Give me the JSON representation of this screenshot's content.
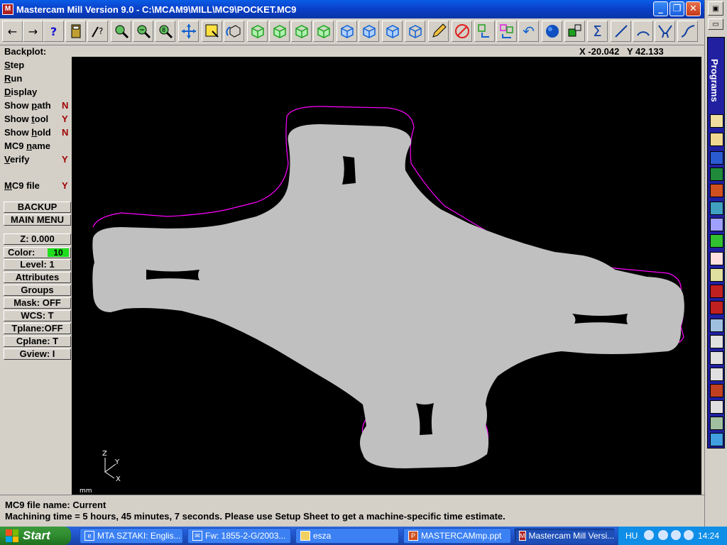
{
  "window": {
    "title": "Mastercam Mill Version 9.0 - C:\\MCAM9\\MILL\\MC9\\POCKET.MC9",
    "app_icon": "mastercam-icon",
    "minimize": "_",
    "maximize": "❐",
    "close": "✕"
  },
  "toolbar": {
    "buttons": [
      {
        "name": "back-arrow-icon",
        "glyph": "←"
      },
      {
        "name": "forward-arrow-icon",
        "glyph": "→"
      },
      {
        "name": "help-icon",
        "glyph": "?"
      },
      {
        "name": "calculator-icon",
        "glyph": ""
      },
      {
        "name": "analyze-icon",
        "glyph": ""
      },
      {
        "name": "zoom-window-icon",
        "glyph": ""
      },
      {
        "name": "zoom-out-icon",
        "glyph": ""
      },
      {
        "name": "zoom-fit-icon",
        "glyph": ""
      },
      {
        "name": "pan-icon",
        "glyph": ""
      },
      {
        "name": "select-window-icon",
        "glyph": ""
      },
      {
        "name": "rotate-view-icon",
        "glyph": ""
      },
      {
        "name": "view-iso-1-icon",
        "glyph": ""
      },
      {
        "name": "view-iso-2-icon",
        "glyph": ""
      },
      {
        "name": "view-iso-3-icon",
        "glyph": ""
      },
      {
        "name": "view-iso-4-icon",
        "glyph": ""
      },
      {
        "name": "view-top-icon",
        "glyph": ""
      },
      {
        "name": "view-front-icon",
        "glyph": ""
      },
      {
        "name": "view-side-icon",
        "glyph": ""
      },
      {
        "name": "view-iso-icon",
        "glyph": ""
      },
      {
        "name": "edit-pencil-icon",
        "glyph": ""
      },
      {
        "name": "erase-icon",
        "glyph": ""
      },
      {
        "name": "transform-icon",
        "glyph": ""
      },
      {
        "name": "translate-icon",
        "glyph": ""
      },
      {
        "name": "undo-icon",
        "glyph": "↶"
      },
      {
        "name": "shade-sphere-icon",
        "glyph": ""
      },
      {
        "name": "group-icon",
        "glyph": ""
      },
      {
        "name": "sum-icon",
        "glyph": "Σ"
      },
      {
        "name": "line-icon",
        "glyph": "╱"
      },
      {
        "name": "arc-icon",
        "glyph": "⌒"
      },
      {
        "name": "fillet-icon",
        "glyph": ""
      },
      {
        "name": "spline-icon",
        "glyph": "∿"
      }
    ]
  },
  "info": {
    "mode_label": "Backplot:",
    "coords": "X -20.042   Y 42.133"
  },
  "menu": {
    "items": [
      {
        "label": "Step",
        "underline": "S",
        "rest": "tep",
        "value": ""
      },
      {
        "label": "Run",
        "underline": "R",
        "rest": "un",
        "value": ""
      },
      {
        "label": "Display",
        "underline": "D",
        "rest": "isplay",
        "value": ""
      },
      {
        "label": "Show path",
        "pre": "Show ",
        "underline": "p",
        "rest": "ath",
        "value": "N"
      },
      {
        "label": "Show tool",
        "pre": "Show ",
        "underline": "t",
        "rest": "ool",
        "value": "Y"
      },
      {
        "label": "Show hold",
        "pre": "Show ",
        "underline": "h",
        "rest": "old",
        "value": "N"
      },
      {
        "label": "MC9 name",
        "pre": "MC9 ",
        "underline": "n",
        "rest": "ame",
        "value": ""
      },
      {
        "label": "Verify",
        "underline": "V",
        "rest": "erify",
        "value": "Y"
      },
      {
        "label": "MC9 file",
        "underline": "M",
        "rest": "C9 file",
        "value": "Y"
      }
    ],
    "backup": "BACKUP",
    "main_menu": "MAIN MENU",
    "z": "Z:  0.000",
    "color_label": "Color:",
    "color_value": "10",
    "level": "Level:  1",
    "attributes": "Attributes",
    "groups": "Groups",
    "mask": "Mask:  OFF",
    "wcs": "WCS:   T",
    "tplane": "Tplane:OFF",
    "cplane": "Cplane:  T",
    "gview": "Gview:   I"
  },
  "viewport": {
    "axis_z": "Z",
    "axis_y": "Y",
    "axis_x": "X",
    "units": "mm",
    "part_color": "#c0c0c0",
    "toolpath_color": "#ff00ff"
  },
  "status": {
    "line1": "MC9 file name: Current",
    "line2": "Machining time = 5 hours, 45 minutes, 7 seconds. Please use Setup Sheet to get a machine-specific time estimate."
  },
  "taskbar": {
    "start": "Start",
    "tasks": [
      {
        "label": "MTA SZTAKI: Englis...",
        "icon": "browser-icon"
      },
      {
        "label": "Fw: 1855-2-G/2003...",
        "icon": "mail-icon"
      },
      {
        "label": "esza",
        "icon": "folder-icon"
      },
      {
        "label": "MASTERCAMmp.ppt",
        "icon": "powerpoint-icon"
      },
      {
        "label": "Mastercam Mill Versi...",
        "icon": "mastercam-icon"
      }
    ],
    "language": "HU",
    "clock": "14:24"
  },
  "right_panel": {
    "programs_label": "Programs"
  }
}
